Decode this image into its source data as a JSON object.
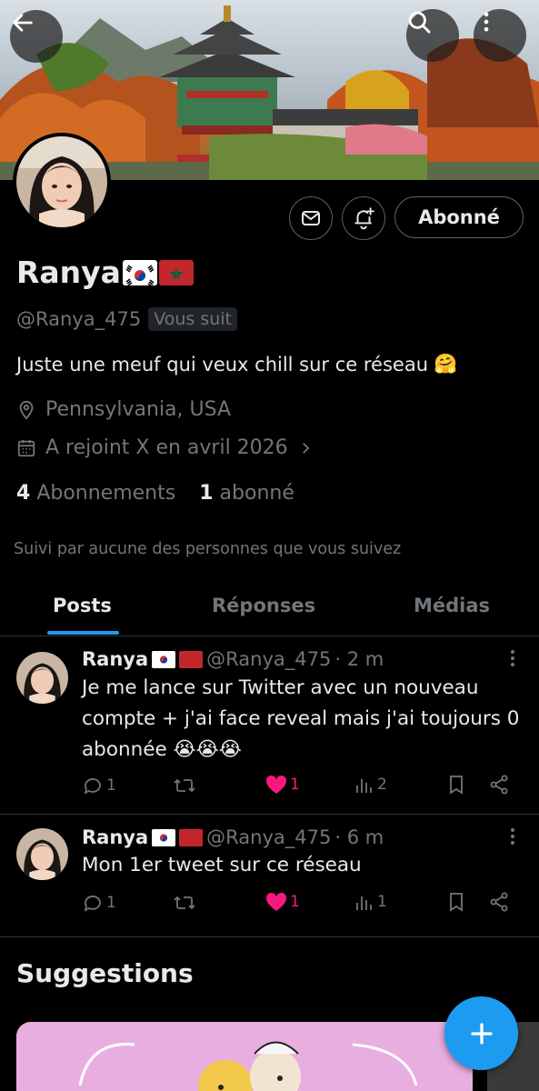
{
  "header": {
    "back_icon": "arrow-left-icon",
    "search_icon": "search-icon",
    "more_icon": "more-vertical-icon"
  },
  "profile": {
    "name": "Ranya",
    "flags": [
      "south-korea-flag",
      "morocco-flag"
    ],
    "handle": "@Ranya_475",
    "follows_you": "Vous suit",
    "bio": "Juste une meuf qui veux chill sur ce réseau",
    "bio_emoji": "🤗",
    "location": "Pennsylvania, USA",
    "joined": "A rejoint X en avril 2026",
    "following_count": "4",
    "following_label": "Abonnements",
    "followers_count": "1",
    "followers_label": "abonné",
    "followed_by": "Suivi par aucune des personnes que vous suivez"
  },
  "actions": {
    "message_icon": "mail-icon",
    "notify_icon": "bell-plus-icon",
    "follow_label": "Abonné"
  },
  "tabs": [
    {
      "label": "Posts",
      "active": true
    },
    {
      "label": "Réponses",
      "active": false
    },
    {
      "label": "Médias",
      "active": false
    }
  ],
  "tweets": [
    {
      "name": "Ranya",
      "handle": "@Ranya_475",
      "time": "· 2 m",
      "text": "Je me lance sur Twitter avec un nouveau compte + j'ai face reveal mais j'ai toujours 0 abonnée",
      "emoji": "😭😭😭",
      "replies": "1",
      "retweets": "",
      "likes": "1",
      "views": "2"
    },
    {
      "name": "Ranya",
      "handle": "@Ranya_475",
      "time": "· 6 m",
      "text": "Mon 1er tweet sur ce réseau",
      "emoji": "",
      "replies": "1",
      "retweets": "",
      "likes": "1",
      "views": "1"
    }
  ],
  "suggestions": {
    "title": "Suggestions"
  },
  "fab": {
    "icon": "plus-icon"
  },
  "colors": {
    "accent": "#1d9bf0",
    "like": "#f91880",
    "muted": "#71767b",
    "text": "#e7e9ea",
    "border": "#2f3336"
  }
}
